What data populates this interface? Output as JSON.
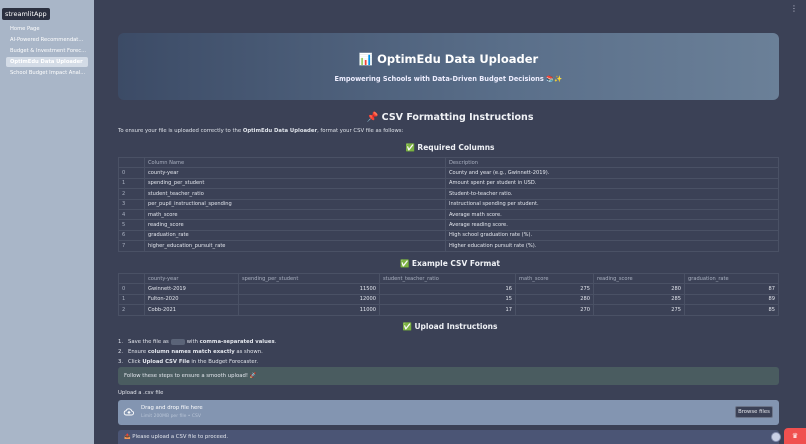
{
  "sidebar": {
    "app_title": "streamlitApp",
    "items": [
      {
        "label": "Home Page"
      },
      {
        "label": "AI-Powered Recommendat..."
      },
      {
        "label": "Budget & Investment Forec..."
      },
      {
        "label": "OptimEdu Data Uploader"
      },
      {
        "label": "School Budget Impact Anal..."
      }
    ]
  },
  "hero": {
    "title": "📊 OptimEdu Data Uploader",
    "subtitle": "Empowering Schools with Data-Driven Budget Decisions 📚✨"
  },
  "instructions_heading": "📌 CSV Formatting Instructions",
  "intro": {
    "prefix": "To ensure your file is uploaded correctly to the ",
    "bold": "OptimEdu Data Uploader",
    "suffix": ", format your CSV file as follows:"
  },
  "required_columns": {
    "heading": "✅ Required Columns",
    "headers": [
      "Column Name",
      "Description"
    ],
    "rows": [
      [
        "0",
        "county-year",
        "County and year (e.g., Gwinnett-2019)."
      ],
      [
        "1",
        "spending_per_student",
        "Amount spent per student in USD."
      ],
      [
        "2",
        "student_teacher_ratio",
        "Student-to-teacher ratio."
      ],
      [
        "3",
        "per_pupil_instructional_spending",
        "Instructional spending per student."
      ],
      [
        "4",
        "math_score",
        "Average math score."
      ],
      [
        "5",
        "reading_score",
        "Average reading score."
      ],
      [
        "6",
        "graduation_rate",
        "High school graduation rate (%)."
      ],
      [
        "7",
        "higher_education_pursuit_rate",
        "Higher education pursuit rate (%)."
      ]
    ]
  },
  "example_csv": {
    "heading": "✅ Example CSV Format",
    "headers": [
      "county-year",
      "spending_per_student",
      "student_teacher_ratio",
      "math_score",
      "reading_score",
      "graduation_rate"
    ],
    "rows": [
      [
        "0",
        "Gwinnett-2019",
        "11500",
        "16",
        "275",
        "280",
        "87"
      ],
      [
        "1",
        "Fulton-2020",
        "12000",
        "15",
        "280",
        "285",
        "89"
      ],
      [
        "2",
        "Cobb-2021",
        "11000",
        "17",
        "270",
        "275",
        "85"
      ]
    ]
  },
  "upload_instructions": {
    "heading": "✅ Upload Instructions",
    "steps": [
      {
        "num": "1.",
        "pre": "Save the file as ",
        "code": ".csv",
        "mid": " with ",
        "bold": "comma-separated values",
        "post": "."
      },
      {
        "num": "2.",
        "pre": "Ensure ",
        "bold": "column names match exactly",
        "post": " as shown."
      },
      {
        "num": "3.",
        "pre": "Click ",
        "bold": "Upload CSV File",
        "post": " in the Budget Forecaster."
      }
    ]
  },
  "note": "Follow these steps to ensure a smooth upload! 🚀",
  "uploader": {
    "label": "Upload a .csv file",
    "drag_text": "Drag and drop file here",
    "limit_text": "Limit 200MB per file • CSV",
    "browse_label": "Browse files"
  },
  "bottom_note": "📤 Please upload a CSV file to proceed.",
  "colors": {
    "background": "#3b4156",
    "sidebar": "#a9b6c8",
    "hero_start": "#3c4b66",
    "hero_end": "#6b8098",
    "deploy": "#f0504f"
  }
}
